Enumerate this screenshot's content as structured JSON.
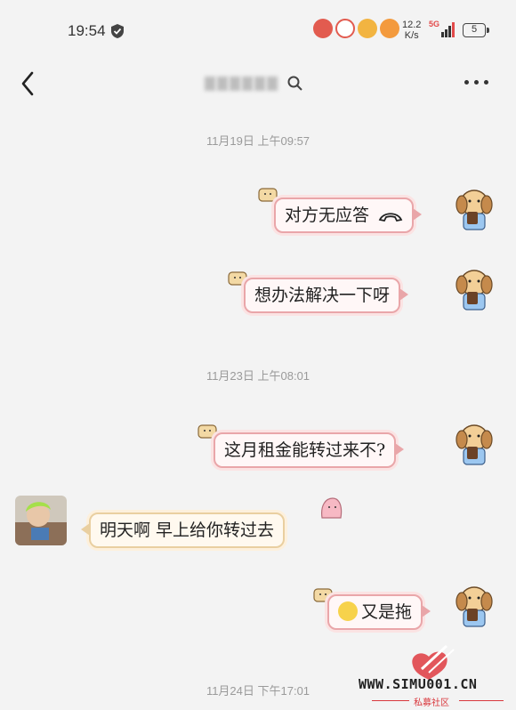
{
  "status": {
    "time": "19:54",
    "net_speed_value": "12.2",
    "net_speed_unit": "K/s",
    "network": "5G",
    "battery": "5"
  },
  "nav": {
    "back_icon": "chevron-left-icon",
    "more_icon": "more-dots-icon"
  },
  "chat": {
    "timestamps": [
      "11月19日  上午09:57",
      "11月23日  上午08:01",
      "11月24日  下午17:01"
    ],
    "messages": [
      {
        "side": "out",
        "text": "对方无应答",
        "icon": "phone-hangup-icon"
      },
      {
        "side": "out",
        "text": "想办法解决一下呀"
      },
      {
        "side": "out",
        "text": "这月租金能转过来不?"
      },
      {
        "side": "in",
        "text": "明天啊  早上给你转过去"
      },
      {
        "side": "out",
        "text": "又是拖",
        "icon": "sweat-emoji-icon"
      }
    ]
  },
  "watermark": {
    "brand": "WWW.SIMU001.CN",
    "sub": "私募社区"
  },
  "colors": {
    "out_bubble_border": "#e9a6a9",
    "in_bubble_border": "#e9cfa0",
    "watermark_red": "#d9383d"
  }
}
